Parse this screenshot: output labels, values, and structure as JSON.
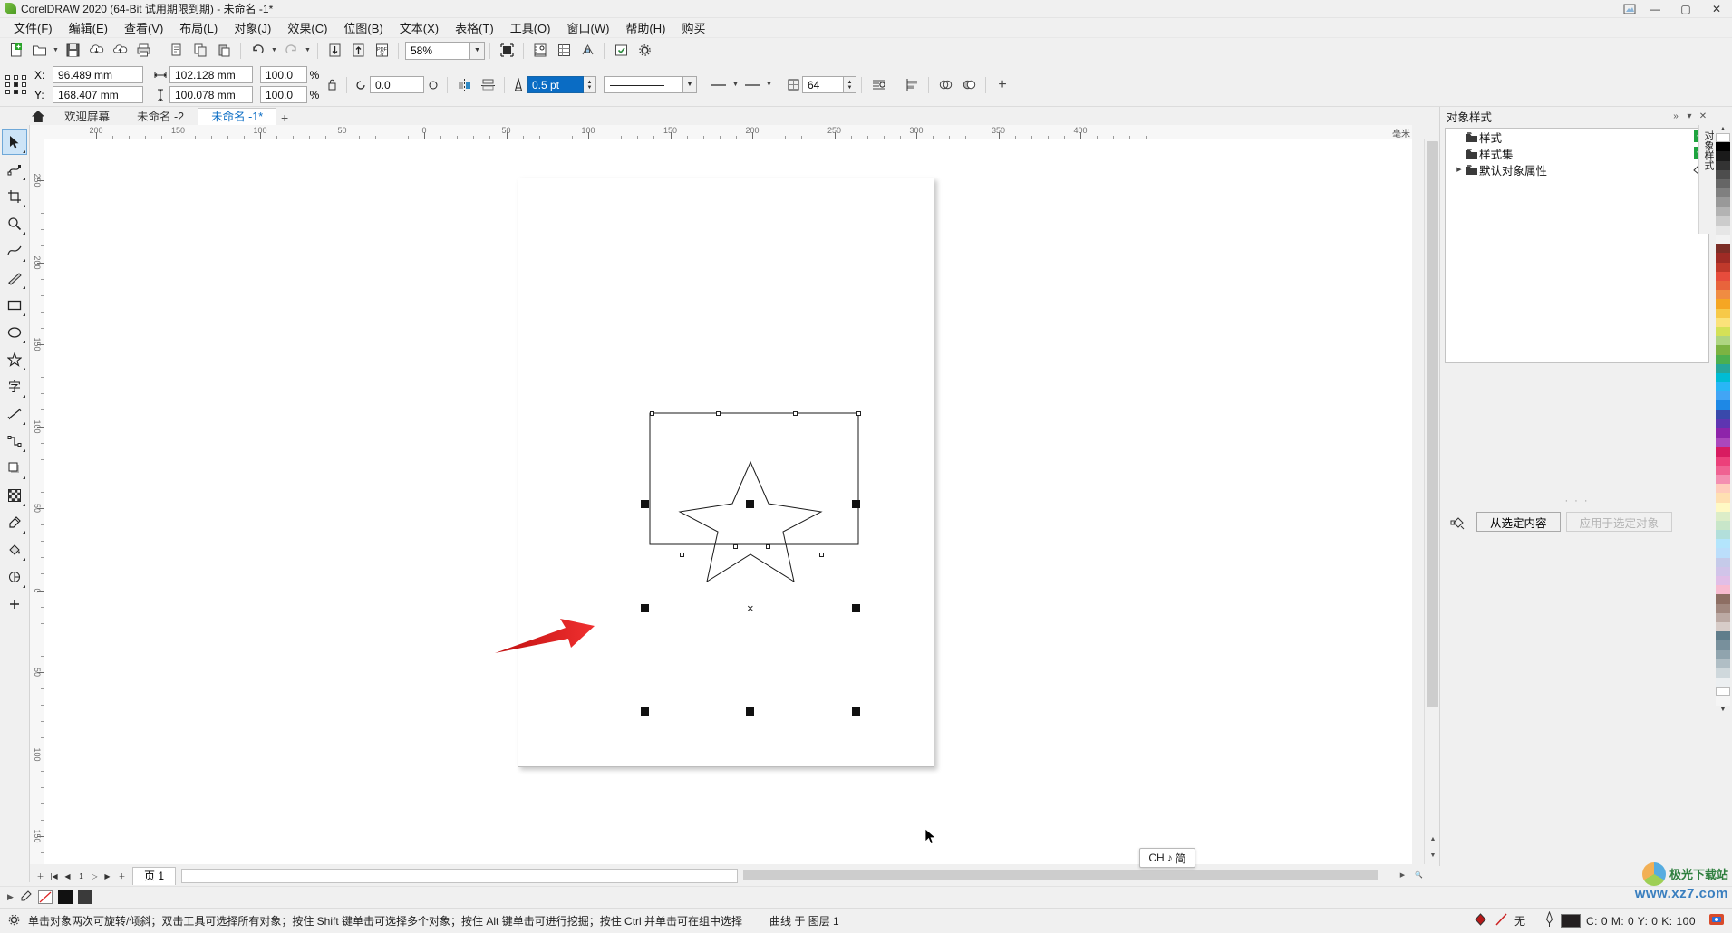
{
  "window": {
    "title": "CorelDRAW 2020 (64-Bit 试用期限到期) - 未命名 -1*",
    "minimize": "—",
    "maximize": "▢",
    "close": "✕",
    "account_icon": "account-icon"
  },
  "menu": {
    "items": [
      {
        "label": "文件(F)",
        "name": "menu-file"
      },
      {
        "label": "编辑(E)",
        "name": "menu-edit"
      },
      {
        "label": "查看(V)",
        "name": "menu-view"
      },
      {
        "label": "布局(L)",
        "name": "menu-layout"
      },
      {
        "label": "对象(J)",
        "name": "menu-object"
      },
      {
        "label": "效果(C)",
        "name": "menu-effects"
      },
      {
        "label": "位图(B)",
        "name": "menu-bitmap"
      },
      {
        "label": "文本(X)",
        "name": "menu-text"
      },
      {
        "label": "表格(T)",
        "name": "menu-table"
      },
      {
        "label": "工具(O)",
        "name": "menu-tools"
      },
      {
        "label": "窗口(W)",
        "name": "menu-window"
      },
      {
        "label": "帮助(H)",
        "name": "menu-help"
      },
      {
        "label": "购买",
        "name": "menu-purchase"
      }
    ]
  },
  "toolbar": {
    "zoom_level": "58%",
    "buttons": [
      {
        "name": "new-document-button",
        "icon": "new-file-icon"
      },
      {
        "name": "open-document-button",
        "icon": "open-folder-icon"
      },
      {
        "name": "save-document-button",
        "icon": "save-disk-icon"
      },
      {
        "name": "import-cloud-button",
        "icon": "cloud-down-icon"
      },
      {
        "name": "export-cloud-button",
        "icon": "cloud-up-icon"
      },
      {
        "name": "print-button",
        "icon": "printer-icon"
      },
      {
        "name": "cut-button",
        "icon": "cut-icon"
      },
      {
        "name": "copy-button",
        "icon": "copy-icon"
      },
      {
        "name": "paste-button",
        "icon": "paste-icon"
      },
      {
        "name": "undo-button",
        "icon": "undo-arrow-icon"
      },
      {
        "name": "redo-button",
        "icon": "redo-arrow-icon"
      },
      {
        "name": "import-button",
        "icon": "import-arrow-down-icon"
      },
      {
        "name": "export-button",
        "icon": "export-arrow-up-icon"
      },
      {
        "name": "publish-pdf-button",
        "icon": "pdf-icon"
      },
      {
        "name": "fullscreen-preview-button",
        "icon": "preview-icon"
      },
      {
        "name": "view-options-button",
        "icon": "ruler-eye-icon"
      },
      {
        "name": "grid-options-button",
        "icon": "grid-icon"
      },
      {
        "name": "snap-options-button",
        "icon": "snap-icon"
      },
      {
        "name": "launch-button",
        "icon": "launch-icon"
      },
      {
        "name": "options-button",
        "icon": "gear-icon"
      }
    ]
  },
  "property_bar": {
    "x_label": "X:",
    "x_value": "96.489 mm",
    "y_label": "Y:",
    "y_value": "168.407 mm",
    "width_value": "102.128 mm",
    "height_value": "100.078 mm",
    "scale_w": "100.0",
    "scale_h": "100.0",
    "percent": "%",
    "lock_ratio_icon": "lock-ratio-icon",
    "angle_value": "0.0",
    "angle_unit_icon": "degree-icon",
    "mirror_h_icon": "mirror-horizontal-icon",
    "mirror_v_icon": "mirror-vertical-icon",
    "outline_width_icon": "outline-pen-icon",
    "outline_width": "0.5 pt",
    "line_style_icon": "line-style-icon",
    "corner_icon": "corner-icon",
    "line_cap_icon": "line-cap-icon",
    "text_wrap_icon": "text-wrap-icon",
    "resolution_value": "64",
    "arrowhead_icon": "arrowhead-icon",
    "align_icon": "align-icon",
    "distribute_icon": "distribute-icon",
    "weld_icon": "weld-icon",
    "trim_icon": "trim-icon",
    "more-icon": "+"
  },
  "tabs": {
    "home_icon": "home-icon",
    "items": [
      {
        "label": "欢迎屏幕",
        "active": false,
        "name": "tab-welcome-screen"
      },
      {
        "label": "未命名 -2",
        "active": false,
        "name": "tab-untitled-2"
      },
      {
        "label": "未命名 -1*",
        "active": true,
        "name": "tab-untitled-1"
      }
    ],
    "add_label": "+"
  },
  "rulers": {
    "unit": "毫米",
    "h_labels": [
      "200",
      "150",
      "100",
      "50",
      "0",
      "50",
      "100",
      "150",
      "200",
      "250",
      "300",
      "350",
      "400"
    ],
    "v_labels": [
      "250",
      "200",
      "150",
      "100",
      "50",
      "0",
      "50",
      "100",
      "150"
    ]
  },
  "toolbox": {
    "tools": [
      {
        "name": "tool-pick",
        "icon": "arrow-pointer-icon",
        "active": true
      },
      {
        "name": "tool-shape",
        "icon": "node-edit-icon",
        "active": false
      },
      {
        "name": "tool-crop",
        "icon": "crop-icon",
        "active": false
      },
      {
        "name": "tool-zoom",
        "icon": "magnifier-icon",
        "active": false
      },
      {
        "name": "tool-freehand",
        "icon": "freehand-curve-icon",
        "active": false
      },
      {
        "name": "tool-artistic-media",
        "icon": "brush-icon",
        "active": false
      },
      {
        "name": "tool-rectangle",
        "icon": "rectangle-icon",
        "active": false
      },
      {
        "name": "tool-ellipse",
        "icon": "ellipse-icon",
        "active": false
      },
      {
        "name": "tool-polygon",
        "icon": "star-polygon-icon",
        "active": false
      },
      {
        "name": "tool-text",
        "icon": "text-icon",
        "active": false
      },
      {
        "name": "tool-parallel-dimension",
        "icon": "dimension-line-icon",
        "active": false
      },
      {
        "name": "tool-connector",
        "icon": "connector-icon",
        "active": false
      },
      {
        "name": "tool-drop-shadow",
        "icon": "drop-shadow-icon",
        "active": false
      },
      {
        "name": "tool-transparency",
        "icon": "transparency-grid-icon",
        "active": false
      },
      {
        "name": "tool-color-eyedropper",
        "icon": "eyedropper-icon",
        "active": false
      },
      {
        "name": "tool-interactive-fill",
        "icon": "fill-bucket-icon",
        "active": false
      },
      {
        "name": "tool-smart-fill",
        "icon": "smart-fill-icon",
        "active": false
      },
      {
        "name": "tool-more",
        "icon": "plus-icon",
        "active": false
      }
    ]
  },
  "canvas": {
    "selection": {
      "center_marker": "×",
      "handle_count": 8
    },
    "annotation_arrow": "red-arrow-annotation",
    "cursor": "mouse-pointer"
  },
  "page_nav": {
    "first": "|◀",
    "prev_page": "◀",
    "prev": "◁",
    "page_indicator": "1",
    "next": "▷",
    "next_page": "▶",
    "last": "▶|",
    "add_page": "＋",
    "page_tab": "页 1"
  },
  "docker": {
    "title": "对象样式",
    "collapse_icon": "chevron-double-right-icon",
    "close_icon": "close-icon",
    "tree": [
      {
        "label": "样式",
        "name": "tree-item-styles",
        "expander": false,
        "plus": true
      },
      {
        "label": "样式集",
        "name": "tree-item-style-sets",
        "expander": false,
        "plus": true
      },
      {
        "label": "默认对象属性",
        "name": "tree-item-default-object-properties",
        "expander": true,
        "plus": false
      }
    ],
    "dots": "· · ·",
    "btn_from_selection": "从选定内容",
    "btn_apply_to_selection": "应用于选定对象",
    "side_tab": "对象样式"
  },
  "ime": {
    "lang": "CH",
    "note_icon": "♪",
    "mode": "简"
  },
  "status_bar": {
    "gear_icon": "gear-icon",
    "hint": "单击对象两次可旋转/倾斜；双击工具可选择所有对象；按住 Shift 键单击可选择多个对象；按住 Alt 键单击可进行挖掘；按住 Ctrl 并单击可在组中选择",
    "layer_info": "曲线 于 图层 1",
    "fill_icon": "fill-swatch-icon",
    "outline_icon": "outline-pen-icon",
    "outline_value": "无",
    "color_pen_icon": "pen-icon",
    "cmyk": "C:  0 M:  0 Y:  0 K:  100"
  },
  "watermark": {
    "site_name": "极光下载站",
    "url": "www.xz7.com"
  },
  "palette_colors": [
    "#ffffff",
    "#000000",
    "#1a1a1a",
    "#333333",
    "#4d4d4d",
    "#666666",
    "#808080",
    "#999999",
    "#b3b3b3",
    "#cccccc",
    "#e6e6e6",
    "#f2f2f2",
    "#7b2d26",
    "#9e2b25",
    "#c0392b",
    "#e74c3c",
    "#e8643c",
    "#f08c42",
    "#f5a623",
    "#f7c948",
    "#fbe27a",
    "#d4e157",
    "#aed581",
    "#7cb342",
    "#4caf50",
    "#26a69a",
    "#00bcd4",
    "#29b6f6",
    "#42a5f5",
    "#1e88e5",
    "#3949ab",
    "#5e35b1",
    "#8e24aa",
    "#ab47bc",
    "#d81b60",
    "#ec407a",
    "#f06292",
    "#f48fb1",
    "#ffccbc",
    "#ffe0b2",
    "#fff9c4",
    "#dcedc8",
    "#c8e6c9",
    "#b2dfdb",
    "#b3e5fc",
    "#bbdefb",
    "#c5cae9",
    "#d1c4e9",
    "#e1bee7",
    "#f8bbd0",
    "#8d6e63",
    "#a1887f",
    "#bcaaa4",
    "#d7ccc8",
    "#607d8b",
    "#78909c",
    "#90a4ae",
    "#b0bec5",
    "#cfd8dc",
    "#eceff1",
    "#ffffff",
    "#f5f5f5"
  ]
}
